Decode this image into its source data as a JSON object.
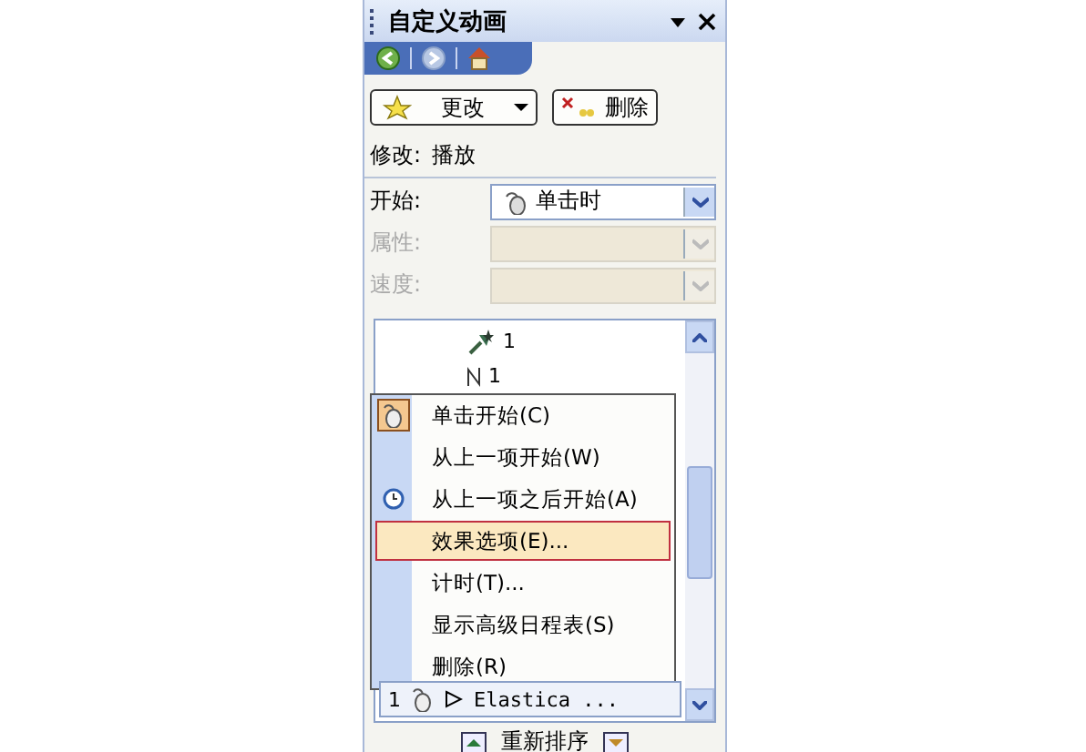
{
  "panel": {
    "title": "自定义动画"
  },
  "toolbar": {
    "change_button": "更改",
    "remove_button": "删除"
  },
  "modify": {
    "label": "修改:",
    "value": "播放"
  },
  "fields": [
    {
      "label": "开始:",
      "value": "单击时",
      "disabled": false
    },
    {
      "label": "属性:",
      "disabled": true
    },
    {
      "label": "速度:",
      "disabled": true
    }
  ],
  "list_items": [
    {
      "number": "1",
      "kind": "pin"
    },
    {
      "number": "1",
      "kind": "sound"
    }
  ],
  "context_menu": [
    {
      "label": "单击开始(C)",
      "checked": true,
      "selected": false
    },
    {
      "label": "从上一项开始(W)",
      "checked": false,
      "selected": false
    },
    {
      "label": "从上一项之后开始(A)",
      "checked": false,
      "selected": false
    },
    {
      "label": "效果选项(E)...",
      "checked": false,
      "selected": true
    },
    {
      "label": "计时(T)...",
      "checked": false,
      "selected": false
    },
    {
      "label": "显示高级日程表(S)",
      "checked": false,
      "selected": false
    },
    {
      "label": "删除(R)",
      "checked": false,
      "selected": false
    }
  ],
  "selected_row": {
    "number": "1",
    "name": "Elastica ..."
  },
  "reorder": {
    "label": "重新排序"
  }
}
